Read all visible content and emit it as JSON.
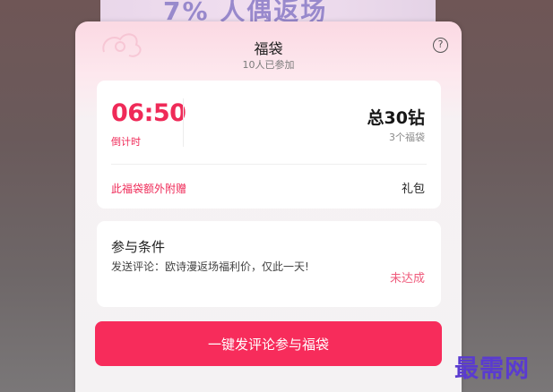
{
  "background": {
    "banner_text": "7% 人偶返场"
  },
  "modal": {
    "title": "福袋",
    "participants": "10人已参加",
    "help_symbol": "?"
  },
  "prize": {
    "countdown": "06:50",
    "countdown_label": "倒计时",
    "total": "总30钻",
    "count": "3个福袋",
    "extra_label": "此福袋额外附赠",
    "extra_value": "礼包"
  },
  "condition": {
    "title": "参与条件",
    "text": "发送评论：欧诗漫返场福利价，仅此一天!",
    "status": "未达成"
  },
  "action": {
    "button_label": "一键发评论参与福袋"
  },
  "watermark": "最需网",
  "colors": {
    "accent": "#ef2a58",
    "button": "#f72c5b",
    "status": "#ef5b7c",
    "watermark": "#5a3bd0"
  }
}
